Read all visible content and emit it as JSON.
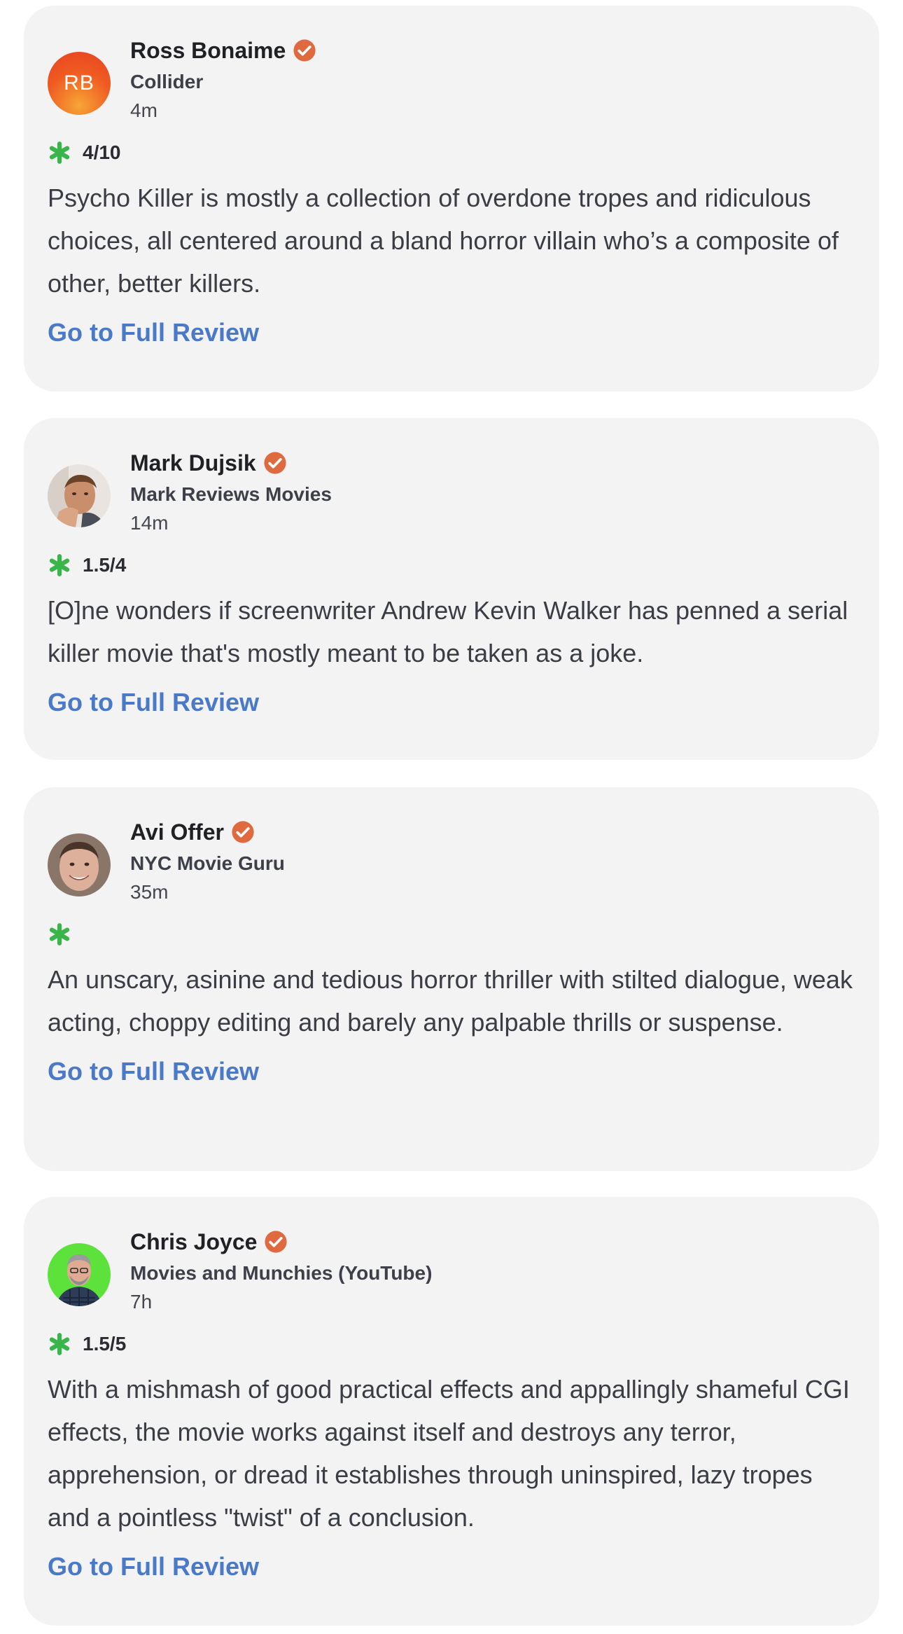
{
  "reviews": [
    {
      "critic": "Ross Bonaime",
      "initials": "RB",
      "publication": "Collider",
      "time": "4m",
      "score": "4/10",
      "quote": "Psycho Killer is mostly a collection of overdone tropes and ridiculous choices, all centered around a bland horror villain who’s a composite of other, better killers.",
      "link_label": "Go to Full Review"
    },
    {
      "critic": "Mark Dujsik",
      "publication": "Mark Reviews Movies",
      "time": "14m",
      "score": "1.5/4",
      "quote": "[O]ne wonders if screenwriter Andrew Kevin Walker has penned a serial killer movie that's mostly meant to be taken as a joke.",
      "link_label": "Go to Full Review"
    },
    {
      "critic": "Avi Offer",
      "publication": "NYC Movie Guru",
      "time": "35m",
      "score": "",
      "quote": "An unscary, asinine and tedious horror thriller with stilted dialogue, weak acting, choppy editing and barely any palpable thrills or suspense.",
      "link_label": "Go to Full Review"
    },
    {
      "critic": "Chris Joyce",
      "publication": "Movies and Munchies (YouTube)",
      "time": "7h",
      "score": "1.5/5",
      "quote": "With a mishmash of good practical effects and appallingly shameful CGI effects, the movie works against itself and destroys any terror, apprehension, or dread it establishes through uninspired, lazy tropes and a pointless \"twist\" of a conclusion.",
      "link_label": "Go to Full Review"
    }
  ],
  "icons": {
    "verified": "verified-check-icon",
    "rotten": "rotten-splat-icon"
  },
  "colors": {
    "verified": "#e06a3f",
    "rotten_green": "#39b54a",
    "link": "#4a79c8",
    "card_bg": "#f3f3f4"
  }
}
